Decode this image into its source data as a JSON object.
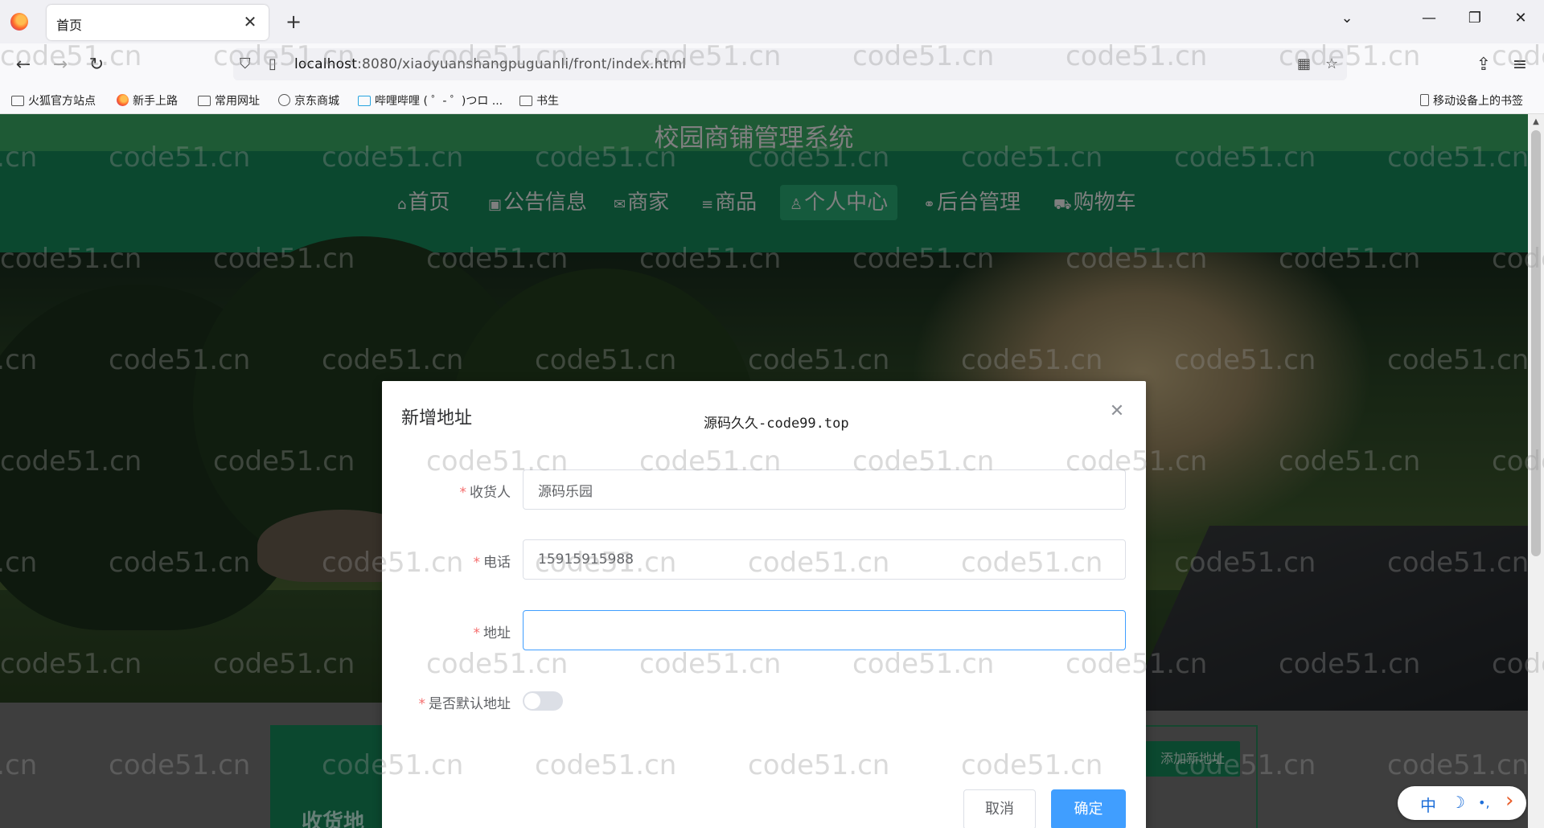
{
  "browser": {
    "tab_title": "首页",
    "tab_close": "✕",
    "new_tab": "+",
    "tabs_menu": "⌄",
    "minimize": "—",
    "restore": "❐",
    "close": "✕",
    "url_host": "localhost",
    "url_rest": ":8080/xiaoyuanshangpuguanli/front/index.html",
    "bookmarks": [
      "火狐官方站点",
      "新手上路",
      "常用网址",
      "京东商城",
      "哔哩哔哩 ( ゜- ゜)つロ ...",
      "书生"
    ],
    "mobile_bookmarks": "移动设备上的书签"
  },
  "site": {
    "title": "校园商铺管理系统",
    "menu": [
      {
        "icon": "⌂",
        "label": "首页"
      },
      {
        "icon": "▣",
        "label": "公告信息"
      },
      {
        "icon": "✉",
        "label": "商家"
      },
      {
        "icon": "≡",
        "label": "商品"
      },
      {
        "icon": "♙",
        "label": "个人中心"
      },
      {
        "icon": "⚭",
        "label": "后台管理"
      },
      {
        "icon": "⛟",
        "label": "购物车"
      }
    ],
    "active_menu": "个人中心",
    "background_add_button": "添加新地址",
    "background_heading": "收货地"
  },
  "dialog": {
    "title": "新增地址",
    "watermark": "源码久久-code99.top",
    "close": "✕",
    "fields": {
      "receiver": {
        "label": "收货人",
        "value": "源码乐园"
      },
      "phone": {
        "label": "电话",
        "value": "15915915988"
      },
      "address": {
        "label": "地址",
        "value": ""
      },
      "is_default": {
        "label": "是否默认地址",
        "on": false
      }
    },
    "cancel": "取消",
    "confirm": "确定"
  },
  "ime": {
    "lang": "中",
    "moon": "☽",
    "punct": "•,",
    "arrow": "›"
  },
  "watermark_text": "code51.cn",
  "colors": {
    "header_green": "#3cb46a",
    "nav_green": "#16905f",
    "active_green": "#2ab57a",
    "primary": "#409eff",
    "required": "#f56c6c"
  }
}
